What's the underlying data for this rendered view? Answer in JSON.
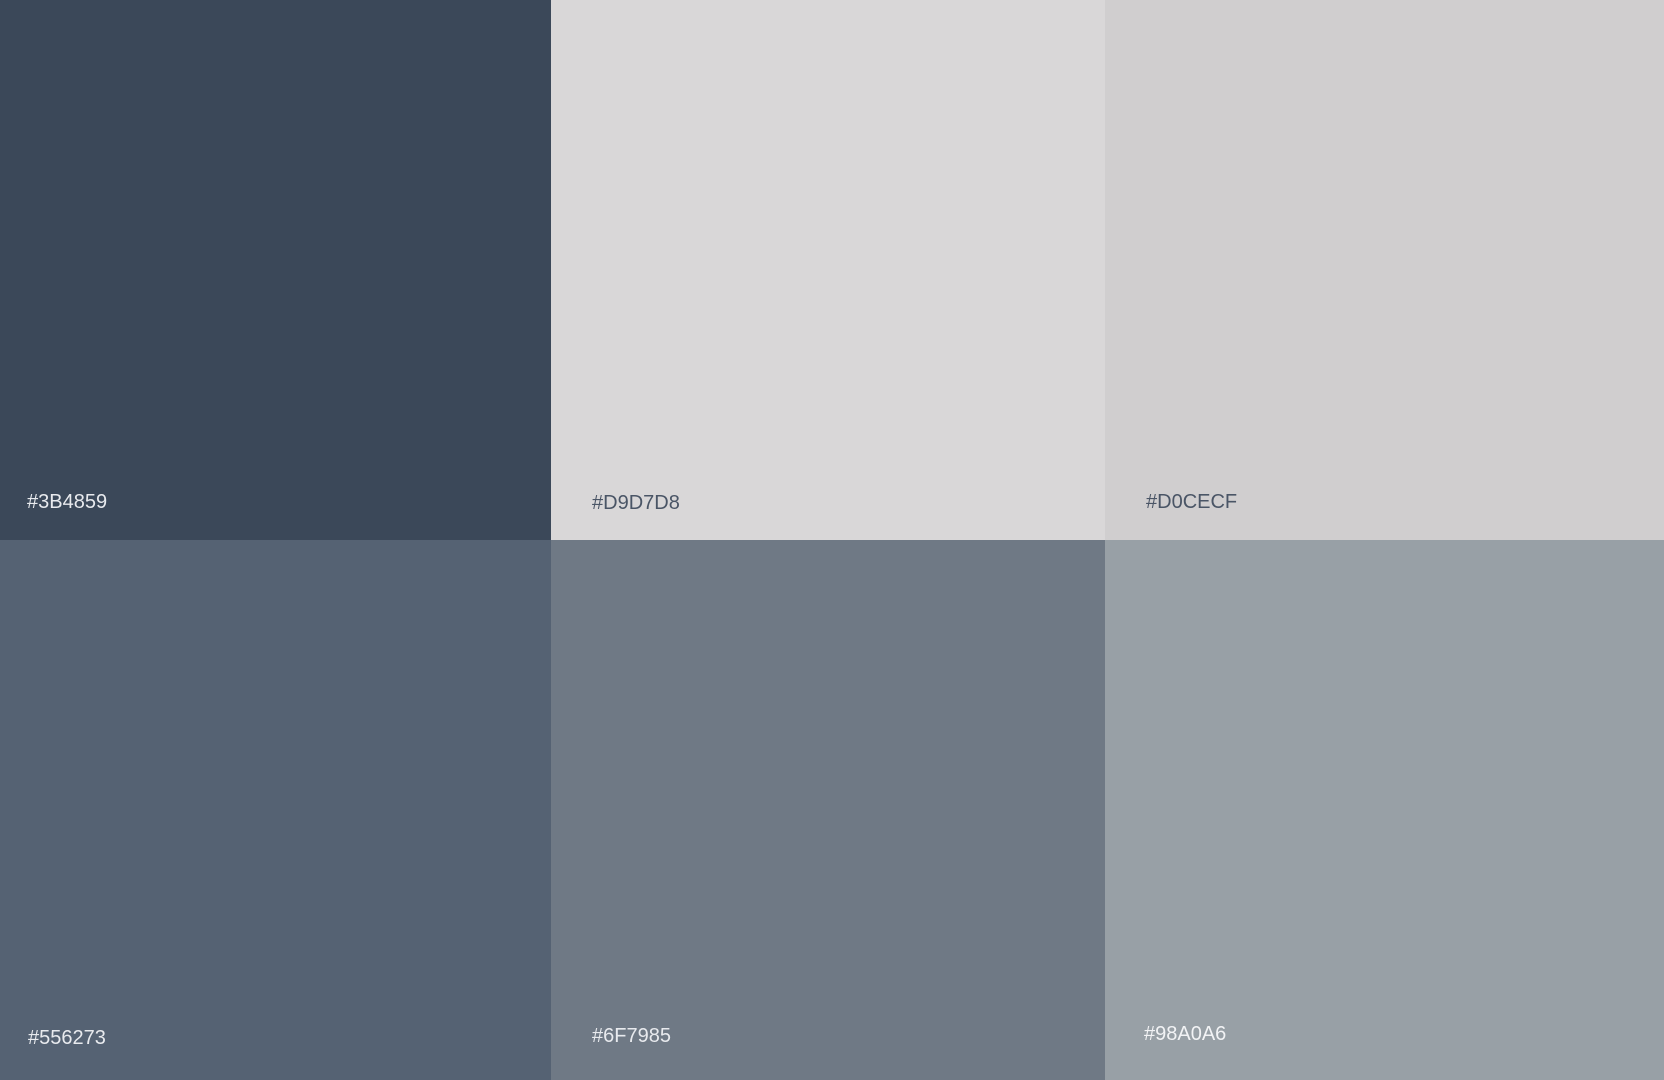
{
  "swatches": [
    {
      "hex": "#3B4859",
      "label": "#3B4859",
      "label_color": "#E8EAEE"
    },
    {
      "hex": "#D9D7D8",
      "label": "#D9D7D8",
      "label_color": "#4A5566"
    },
    {
      "hex": "#D0CECF",
      "label": "#D0CECF",
      "label_color": "#4A5566"
    },
    {
      "hex": "#556273",
      "label": "#556273",
      "label_color": "#E8EAEE"
    },
    {
      "hex": "#6F7985",
      "label": "#6F7985",
      "label_color": "#E8EAEE"
    },
    {
      "hex": "#98A0A6",
      "label": "#98A0A6",
      "label_color": "#F2F3F5"
    }
  ]
}
